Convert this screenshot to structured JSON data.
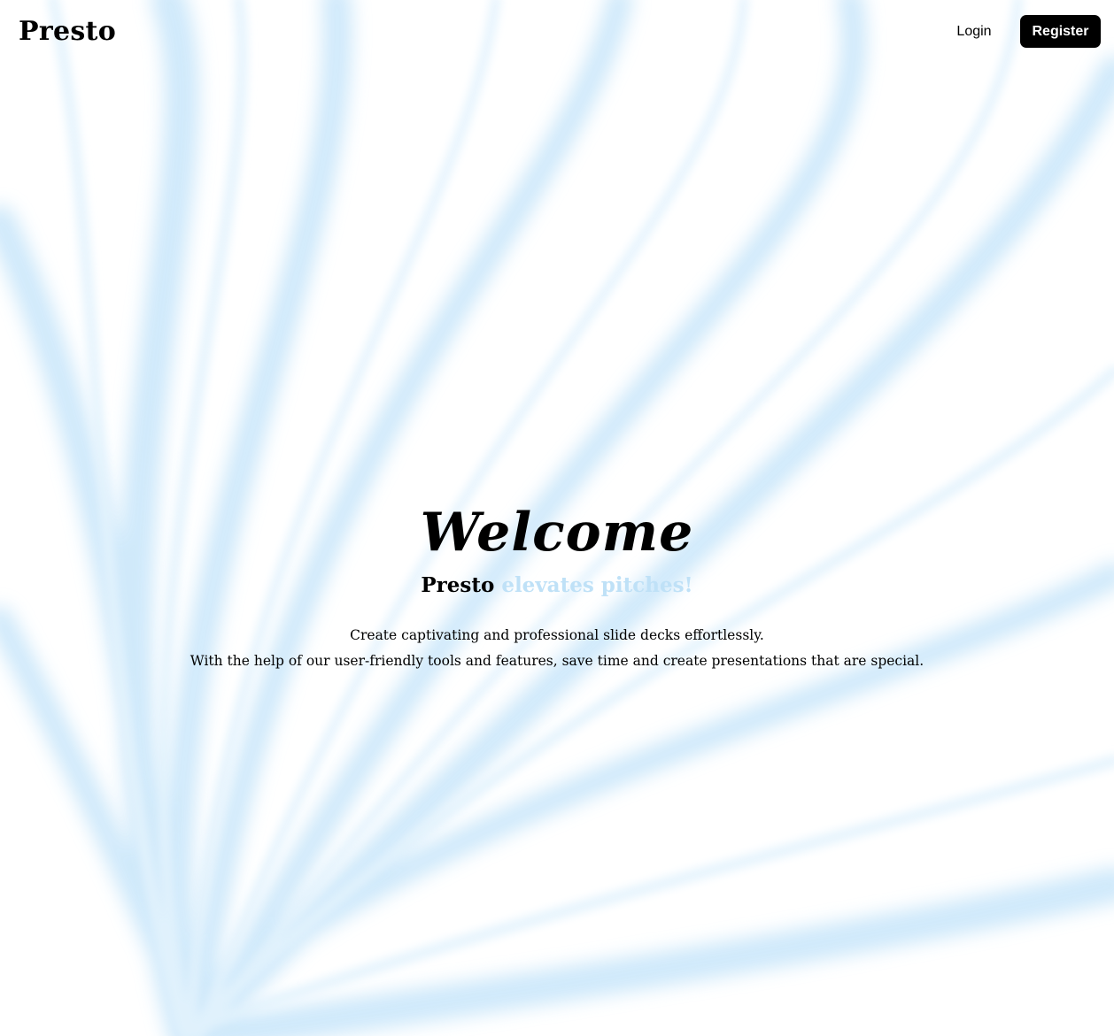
{
  "nav": {
    "brand": "Presto",
    "login_label": "Login",
    "register_label": "Register"
  },
  "hero": {
    "heading": "Welcome",
    "tagline_brand": "Presto",
    "tagline_accent": "elevates pitches!",
    "line1": "Create captivating and professional slide decks effortlessly.",
    "line2": "With the help of our user-friendly tools and features, save time and create presentations that are special."
  },
  "colors": {
    "accent": "#bfe1f7",
    "button_bg": "#000000",
    "background_wave": "#d8eefb"
  }
}
